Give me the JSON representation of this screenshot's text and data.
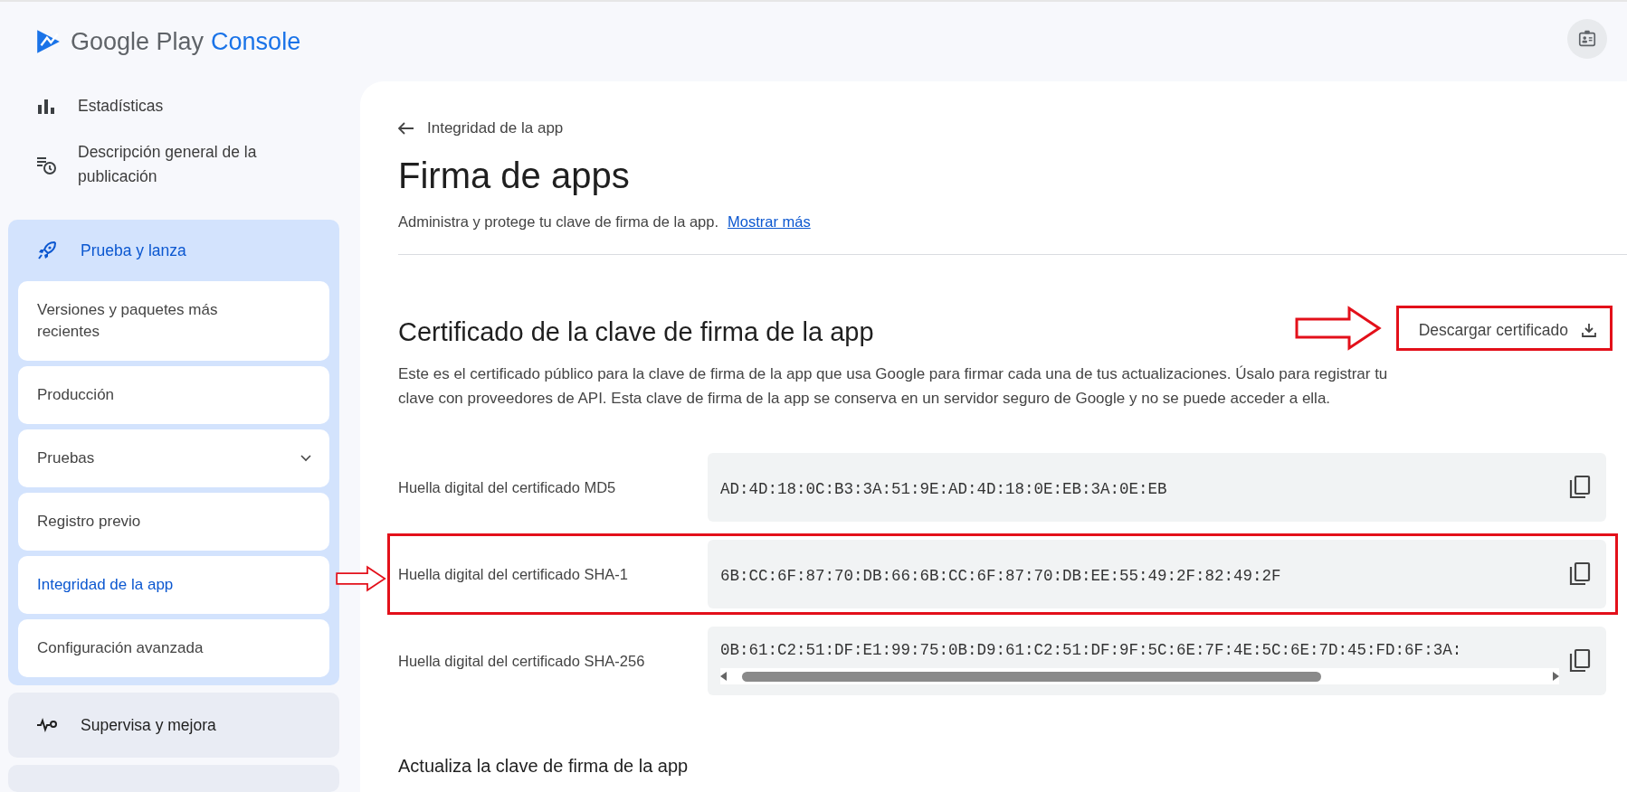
{
  "brand": {
    "name": "Google Play",
    "product": "Console"
  },
  "sidebar": {
    "items": [
      {
        "label": "Estadísticas",
        "selected": false
      },
      {
        "label": "Descripción general de la publicación",
        "selected": false
      }
    ],
    "groups": [
      {
        "label": "Prueba y lanza",
        "expanded": true,
        "children": [
          {
            "label": "Versiones y paquetes más recientes",
            "selected": false,
            "expandable": false
          },
          {
            "label": "Producción",
            "selected": false,
            "expandable": false
          },
          {
            "label": "Pruebas",
            "selected": false,
            "expandable": true
          },
          {
            "label": "Registro previo",
            "selected": false,
            "expandable": false
          },
          {
            "label": "Integridad de la app",
            "selected": true,
            "expandable": false
          },
          {
            "label": "Configuración avanzada",
            "selected": false,
            "expandable": false
          }
        ]
      },
      {
        "label": "Supervisa y mejora",
        "expanded": false
      }
    ]
  },
  "page": {
    "back_link": "Integridad de la app",
    "title": "Firma de apps",
    "subtitle": "Administra y protege tu clave de firma de la app.",
    "more_link": "Mostrar más"
  },
  "certificate": {
    "heading": "Certificado de la clave de firma de la app",
    "download": {
      "label": "Descargar certificado",
      "highlighted": true
    },
    "description": "Este es el certificado público para la clave de firma de la app que usa Google para firmar cada una de tus actualizaciones. Úsalo para registrar tu clave con proveedores de API. Esta clave de firma de la app se conserva en un servidor seguro de Google y no se puede acceder a ella.",
    "fingerprints": [
      {
        "label": "Huella digital del certificado MD5",
        "value": "AD:4D:18:0C:B3:3A:51:9E:AD:4D:18:0E:EB:3A:0E:EB",
        "highlighted": false,
        "scrollable": false
      },
      {
        "label": "Huella digital del certificado SHA-1",
        "value": "6B:CC:6F:87:70:DB:66:6B:CC:6F:87:70:DB:EE:55:49:2F:82:49:2F",
        "highlighted": true,
        "scrollable": false
      },
      {
        "label": "Huella digital del certificado SHA-256",
        "value": "0B:61:C2:51:DF:E1:99:75:0B:D9:61:C2:51:DF:9F:5C:6E:7F:4E:5C:6E:7D:45:FD:6F:3A:",
        "highlighted": false,
        "scrollable": true
      }
    ]
  },
  "next_section": {
    "heading": "Actualiza la clave de firma de la app"
  }
}
